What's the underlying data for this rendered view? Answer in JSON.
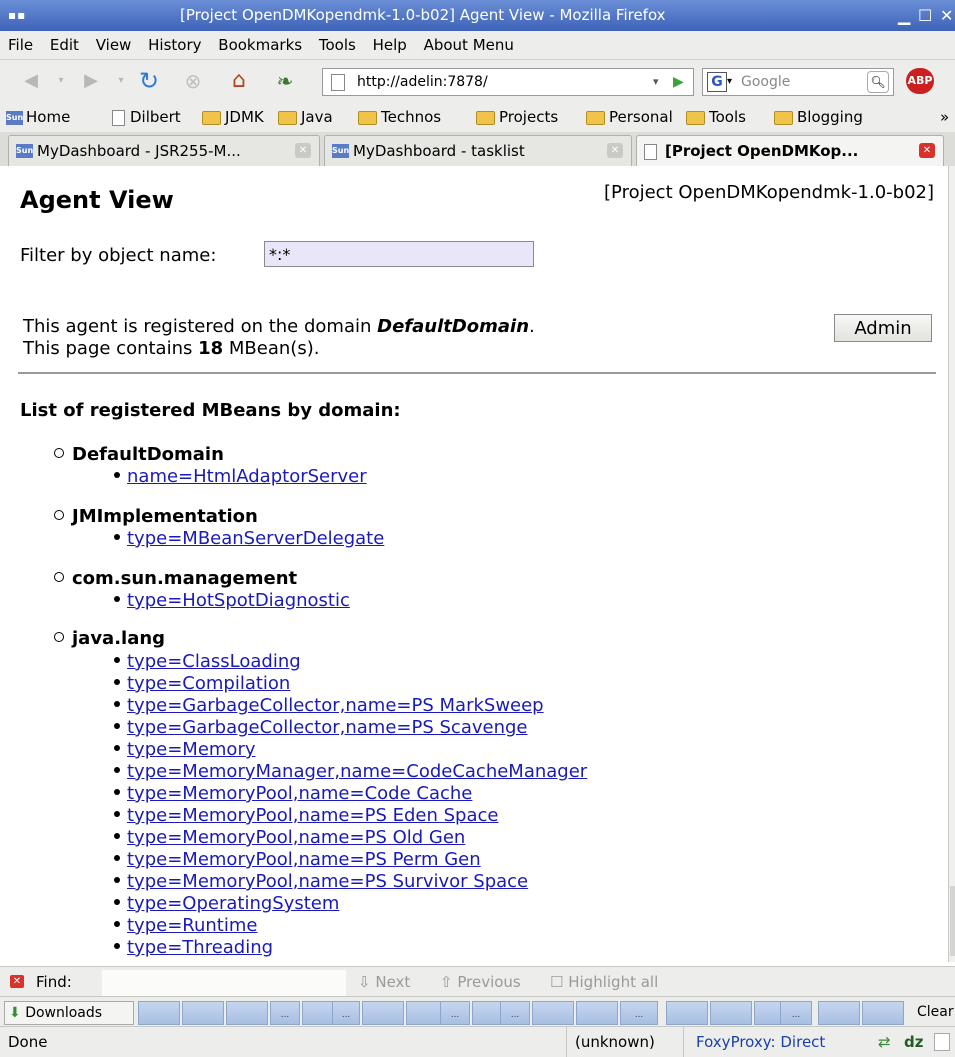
{
  "window": {
    "title": "[Project OpenDMKopendmk-1.0-b02] Agent View - Mozilla Firefox"
  },
  "menubar": {
    "items": [
      "File",
      "Edit",
      "View",
      "History",
      "Bookmarks",
      "Tools",
      "Help",
      "About Menu"
    ]
  },
  "navbar": {
    "url": "http://adelin:7878/",
    "search_placeholder": "Google",
    "adblock_label": "ABP"
  },
  "bookmarks": {
    "items": [
      "Home",
      "Dilbert",
      "JDMK",
      "Java",
      "Technos",
      "Projects",
      "Personal",
      "Tools",
      "Blogging"
    ],
    "overflow": "»"
  },
  "tabs": [
    {
      "label": "MyDashboard - JSR255-M..."
    },
    {
      "label": "MyDashboard - tasklist"
    },
    {
      "label": "[Project OpenDMKop..."
    }
  ],
  "page": {
    "title": "Agent View",
    "project_label": "[Project OpenDMKopendmk-1.0-b02]",
    "filter_label": "Filter by object name:",
    "filter_value": "*:*",
    "registered_prefix": "This agent is registered on the domain",
    "registered_domain": "DefaultDomain",
    "registered_suffix": ".",
    "count_prefix": "This page contains",
    "count_value": "18",
    "count_suffix": "MBean(s).",
    "admin_label": "Admin",
    "list_heading": "List of registered MBeans by domain:",
    "domains": [
      {
        "name": "DefaultDomain",
        "mbeans": [
          "name=HtmlAdaptorServer"
        ]
      },
      {
        "name": "JMImplementation",
        "mbeans": [
          "type=MBeanServerDelegate"
        ]
      },
      {
        "name": "com.sun.management",
        "mbeans": [
          "type=HotSpotDiagnostic"
        ]
      },
      {
        "name": "java.lang",
        "mbeans": [
          "type=ClassLoading",
          "type=Compilation",
          "type=GarbageCollector,name=PS MarkSweep",
          "type=GarbageCollector,name=PS Scavenge",
          "type=Memory",
          "type=MemoryManager,name=CodeCacheManager",
          "type=MemoryPool,name=Code Cache",
          "type=MemoryPool,name=PS Eden Space",
          "type=MemoryPool,name=PS Old Gen",
          "type=MemoryPool,name=PS Perm Gen",
          "type=MemoryPool,name=PS Survivor Space",
          "type=OperatingSystem",
          "type=Runtime",
          "type=Threading"
        ]
      }
    ]
  },
  "findbar": {
    "label": "Find:",
    "next": "Next",
    "previous": "Previous",
    "highlight": "Highlight all"
  },
  "downloads": {
    "label": "Downloads",
    "slot_text": "...",
    "clear_label": "Clear"
  },
  "status": {
    "text": "Done",
    "unknown": "(unknown)",
    "foxyproxy": "FoxyProxy: Direct",
    "dz": "dz"
  }
}
